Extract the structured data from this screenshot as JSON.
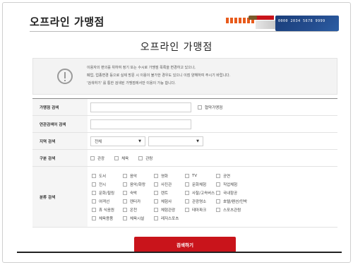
{
  "header": {
    "title": "오프라인 가맹점",
    "card_number": "0000 2034 5678 9999"
  },
  "page_title": "오프라인 가맹점",
  "notice": {
    "lines": [
      "이용자의 편의를 위하여 정기 또는 수시로 가맹점 목록을 변경하고 있으나,",
      "폐업, 업종변경 등으로 실제 방문 시 이용이 불가한 경우도 있으니 이점 양해하여 주시기 바랍니다.",
      "'검색하기' 를 통한 검색된 가맹점에서만 이용이 가능 합니다."
    ]
  },
  "form": {
    "store_search": {
      "label": "가맹점 검색",
      "value": "",
      "option": "협약가맹점"
    },
    "related_search": {
      "label": "연관검색어 검색",
      "value": ""
    },
    "region": {
      "label": "지역 검색",
      "select1": "전체",
      "select2": ""
    },
    "type_search": {
      "label": "구분 검색",
      "options": [
        "관광",
        "체육",
        "관람"
      ]
    },
    "category": {
      "label": "분류 검색",
      "options": [
        "도서",
        "음악",
        "영화",
        "TV",
        "공연",
        "전시",
        "음악/화랑",
        "사진관",
        "문화체험",
        "직업체험",
        "문화/힐링",
        "숙박",
        "렌트",
        "사찰/고속버스",
        "국내항공",
        "여객선",
        "렌터카",
        "체험사",
        "관광명소",
        "호텔/펜션/민박",
        "휴 식음원",
        "온천",
        "체험관광",
        "테마파크",
        "스포츠관람",
        "체육용품",
        "체육시설",
        "레저스포츠"
      ]
    }
  },
  "search_button": "검색하기"
}
